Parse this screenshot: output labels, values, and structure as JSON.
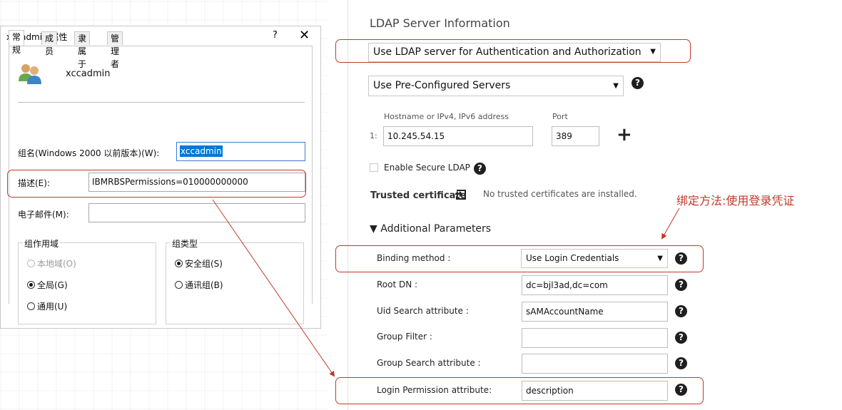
{
  "dialog": {
    "title": "xccadmin 属性",
    "help": "?",
    "close": "✕",
    "tabs": [
      {
        "label": "常规",
        "active": true
      },
      {
        "label": "成员",
        "active": false
      },
      {
        "label": "隶属于",
        "active": false
      },
      {
        "label": "管理者",
        "active": false
      }
    ],
    "user_name": "xccadmin",
    "group_name_label": "组名(Windows 2000 以前版本)(W):",
    "group_name_value": "xccadmin",
    "description_label": "描述(E):",
    "description_value": "IBMRBSPermissions=010000000000",
    "email_label": "电子邮件(M):",
    "email_value": "",
    "group_scope": {
      "legend": "组作用域",
      "options": [
        {
          "label": "本地域(O)",
          "checked": false,
          "disabled": true
        },
        {
          "label": "全局(G)",
          "checked": true,
          "disabled": false
        },
        {
          "label": "通用(U)",
          "checked": false,
          "disabled": false
        }
      ]
    },
    "group_type": {
      "legend": "组类型",
      "options": [
        {
          "label": "安全组(S)",
          "checked": true
        },
        {
          "label": "通讯组(B)",
          "checked": false
        }
      ]
    }
  },
  "ldap": {
    "title": "LDAP Server Information",
    "usage_select": "Use LDAP server for Authentication and Authorization",
    "server_select": "Use Pre-Configured Servers",
    "hostname_label": "Hostname or IPv4, IPv6 address",
    "port_label": "Port",
    "row_index": "1:",
    "hostname_value": "10.245.54.15",
    "port_value": "389",
    "add": "+",
    "secure_label": "Enable Secure LDAP",
    "trusted_label": "Trusted certificate",
    "trusted_status": "No trusted certificates are installed.",
    "additional_label": "Additional Parameters",
    "additional_toggle": "▼",
    "params": {
      "binding_label": "Binding method :",
      "binding_value": "Use Login Credentials",
      "root_dn_label": "Root DN :",
      "root_dn_value": "dc=bjl3ad,dc=com",
      "uid_label": "Uid Search attribute :",
      "uid_value": "sAMAccountName",
      "group_filter_label": "Group Filter :",
      "group_filter_value": "",
      "group_search_label": "Group Search attribute :",
      "group_search_value": "",
      "login_perm_label": "Login Permission attribute:",
      "login_perm_value": "description"
    }
  },
  "annotation": {
    "binding_note": "绑定方法:使用登录凭证",
    "color": "#c0392b"
  }
}
